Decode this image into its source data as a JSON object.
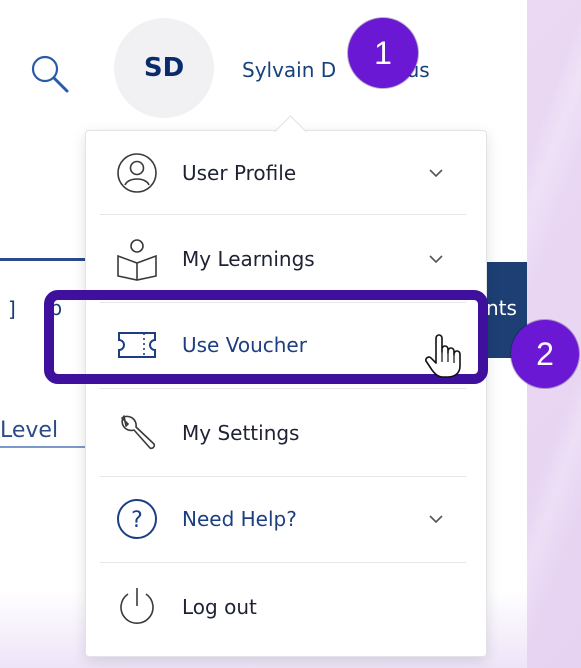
{
  "header": {
    "avatar_initials": "SD",
    "user_name": "Sylvain D",
    "user_name_tail": "sus",
    "icons": {
      "search": "search-icon"
    }
  },
  "annotations": {
    "badge_1": "1",
    "badge_2": "2",
    "highlight_color": "#3f0f9e",
    "badge_color": "#6b18d4"
  },
  "background_page": {
    "tab_fragment_left": "]",
    "tab_fragment_lib": "ib",
    "dark_block_text": "nts",
    "level_text": "Level"
  },
  "dropdown": {
    "items": [
      {
        "label": "User Profile",
        "icon": "user-profile-icon",
        "has_chevron": true
      },
      {
        "label": "My Learnings",
        "icon": "book-reader-icon",
        "has_chevron": true
      },
      {
        "label": "Use Voucher",
        "icon": "voucher-ticket-icon",
        "has_chevron": false,
        "highlighted": true
      },
      {
        "label": "My Settings",
        "icon": "wrench-icon",
        "has_chevron": false
      },
      {
        "label": "Need Help?",
        "icon": "help-question-icon",
        "has_chevron": true
      },
      {
        "label": "Log out",
        "icon": "power-icon",
        "has_chevron": false
      }
    ]
  },
  "colors": {
    "brand_navy": "#1d3f74",
    "text_dark": "#1e2233",
    "link_blue": "#1d3f82"
  }
}
